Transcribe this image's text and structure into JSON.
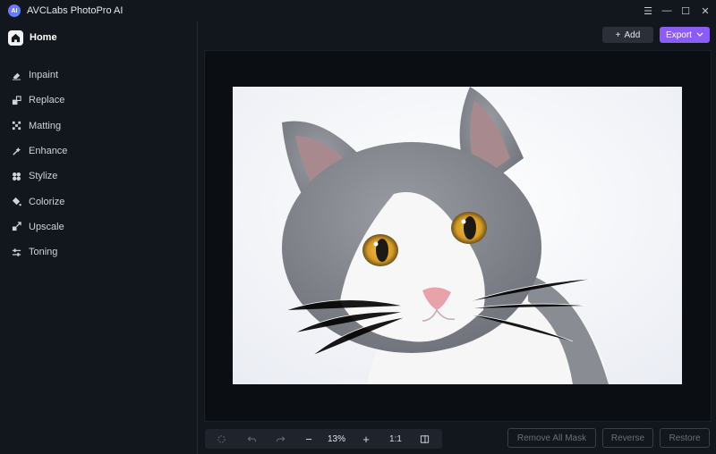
{
  "app": {
    "title": "AVCLabs PhotoPro AI",
    "logo_text": "AI"
  },
  "window_controls": {
    "menu": "☰",
    "minimize": "—",
    "maximize": "☐",
    "close": "✕"
  },
  "sidebar": {
    "home_label": "Home",
    "items": [
      {
        "label": "Inpaint",
        "icon": "eraser-icon"
      },
      {
        "label": "Replace",
        "icon": "replace-icon"
      },
      {
        "label": "Matting",
        "icon": "matting-icon"
      },
      {
        "label": "Enhance",
        "icon": "enhance-icon"
      },
      {
        "label": "Stylize",
        "icon": "stylize-icon"
      },
      {
        "label": "Colorize",
        "icon": "colorize-icon"
      },
      {
        "label": "Upscale",
        "icon": "upscale-icon"
      },
      {
        "label": "Toning",
        "icon": "toning-icon"
      }
    ]
  },
  "header": {
    "add_label": "Add",
    "add_glyph": "+",
    "export_label": "Export",
    "export_glyph": "⌄"
  },
  "toolbar": {
    "zoom_out": "−",
    "zoom_level": "13%",
    "zoom_in": "+",
    "actual_size": "1:1"
  },
  "actions": {
    "remove_all_mask": "Remove All Mask",
    "reverse": "Reverse",
    "restore": "Restore"
  },
  "colors": {
    "accent": "#8b5cf6",
    "background": "#12161d",
    "canvas": "#0b0e13"
  }
}
